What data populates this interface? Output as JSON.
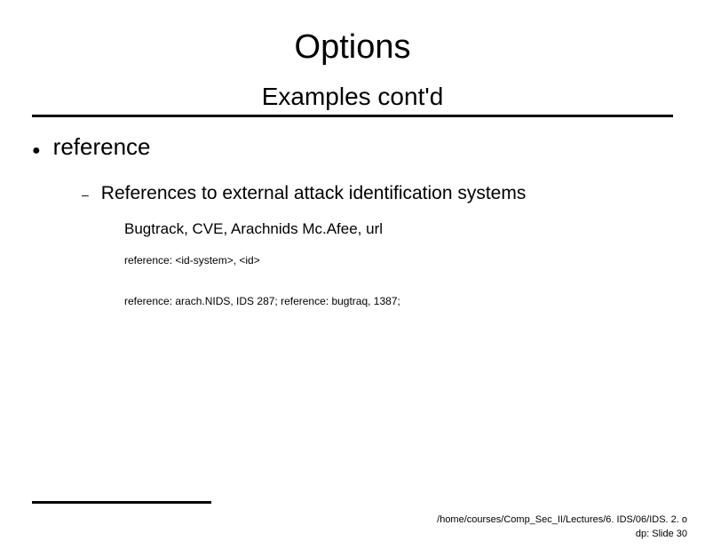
{
  "title": "Options",
  "subtitle": "Examples cont'd",
  "bullet": {
    "label": "reference",
    "sub": {
      "label": "References to external attack identification systems",
      "details": {
        "d1": "Bugtrack, CVE, Arachnids Mc.Afee, url",
        "d2": "reference: <id-system>, <id>",
        "d3": "reference: arach.NIDS, IDS 287; reference: bugtraq, 1387;"
      }
    }
  },
  "footer": {
    "path": "/home/courses/Comp_Sec_II/Lectures/6. IDS/06/IDS. 2. o",
    "slide": "dp:   Slide 30"
  }
}
